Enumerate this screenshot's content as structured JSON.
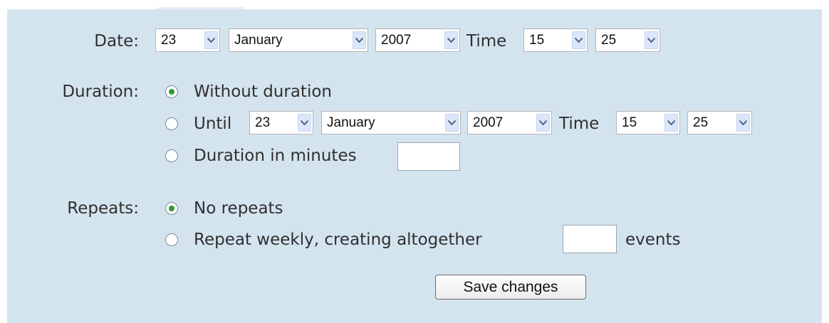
{
  "date": {
    "label": "Date:",
    "day": "23",
    "month": "January",
    "year": "2007",
    "time_label": "Time",
    "hour": "15",
    "minute": "25"
  },
  "duration": {
    "label": "Duration:",
    "options": [
      {
        "label": "Without duration",
        "checked": true
      },
      {
        "label": "Until",
        "checked": false
      },
      {
        "label": "Duration in minutes",
        "checked": false
      }
    ],
    "until": {
      "day": "23",
      "month": "January",
      "year": "2007",
      "time_label": "Time",
      "hour": "15",
      "minute": "25"
    },
    "minutes_value": ""
  },
  "repeats": {
    "label": "Repeats:",
    "options": [
      {
        "label": "No repeats",
        "checked": true
      },
      {
        "label": "Repeat weekly, creating altogether",
        "checked": false
      }
    ],
    "count_value": "",
    "suffix": "events"
  },
  "save_label": "Save changes"
}
